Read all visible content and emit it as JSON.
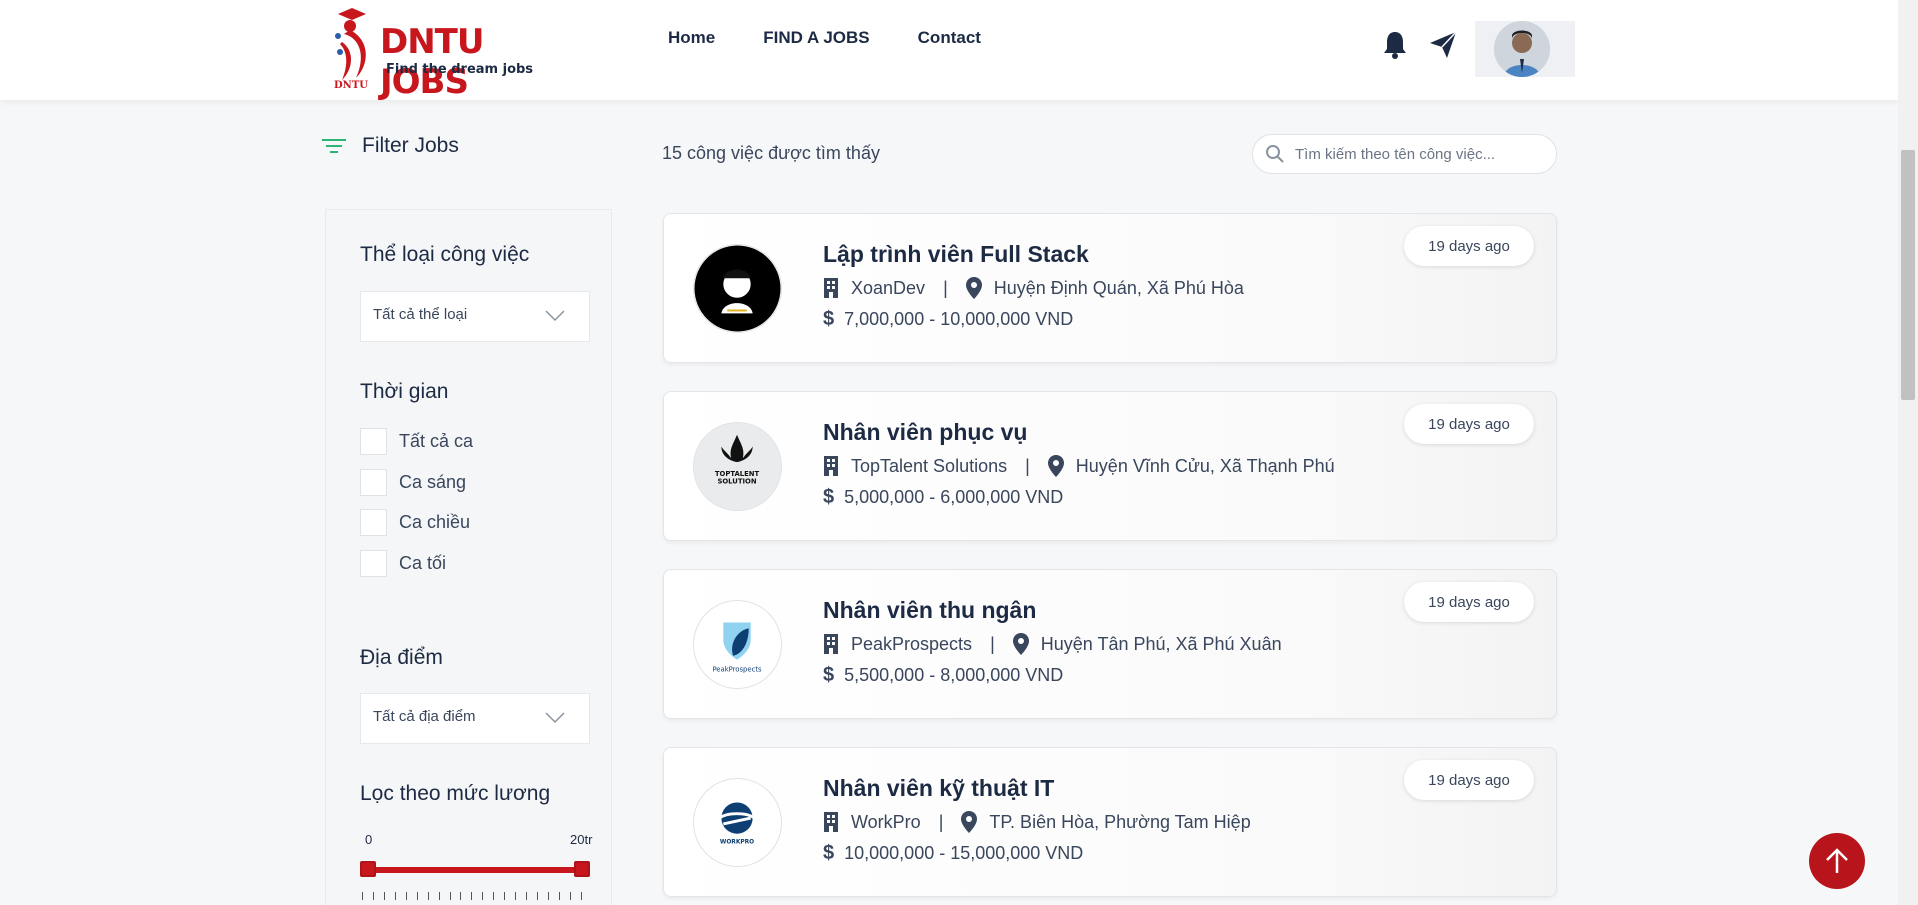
{
  "header": {
    "logo_text": "DNTU JOBS",
    "logo_tagline": "Find the dream jobs",
    "logo_mark_text": "DNTU",
    "nav": [
      "Home",
      "FIND A JOBS",
      "Contact"
    ]
  },
  "filter": {
    "title": "Filter Jobs",
    "category": {
      "title": "Thể loại công việc",
      "selected": "Tất cả thể loại"
    },
    "time": {
      "title": "Thời gian",
      "options": [
        "Tất cả ca",
        "Ca sáng",
        "Ca chiều",
        "Ca tối"
      ]
    },
    "location": {
      "title": "Địa điểm",
      "selected": "Tất cả địa điểm"
    },
    "salary": {
      "title": "Lọc theo mức lương",
      "min_label": "0",
      "max_label": "20tr",
      "min": 0,
      "max": 1
    }
  },
  "results": {
    "count_text": "15 công việc được tìm thấy",
    "search_placeholder": "Tìm kiếm theo tên công việc..."
  },
  "jobs": [
    {
      "title": "Lập trình viên Full Stack",
      "company": "XoanDev",
      "location": "Huyện Định Quán, Xã Phú Hòa",
      "salary": "7,000,000 - 10,000,000 VND",
      "posted": "19 days ago"
    },
    {
      "title": "Nhân viên phục vụ",
      "company": "TopTalent Solutions",
      "location": "Huyện Vĩnh Cửu, Xã Thạnh Phú",
      "salary": "5,000,000 - 6,000,000 VND",
      "posted": "19 days ago"
    },
    {
      "title": "Nhân viên thu ngân",
      "company": "PeakProspects",
      "location": "Huyện Tân Phú, Xã Phú Xuân",
      "salary": "5,500,000 - 8,000,000 VND",
      "posted": "19 days ago"
    },
    {
      "title": "Nhân viên kỹ thuật IT",
      "company": "WorkPro",
      "location": "TP. Biên Hòa, Phường Tam Hiệp",
      "salary": "10,000,000 - 15,000,000 VND",
      "posted": "19 days ago"
    }
  ],
  "colors": {
    "brand": "#c8161d",
    "text": "#1d2a44",
    "filter_icon": "#2bb673"
  },
  "icons": [
    "bell-icon",
    "paper-plane-icon",
    "filter-icon",
    "search-icon",
    "building-icon",
    "map-pin-icon",
    "dollar-icon",
    "arrow-up-icon",
    "chevron-down-icon"
  ]
}
